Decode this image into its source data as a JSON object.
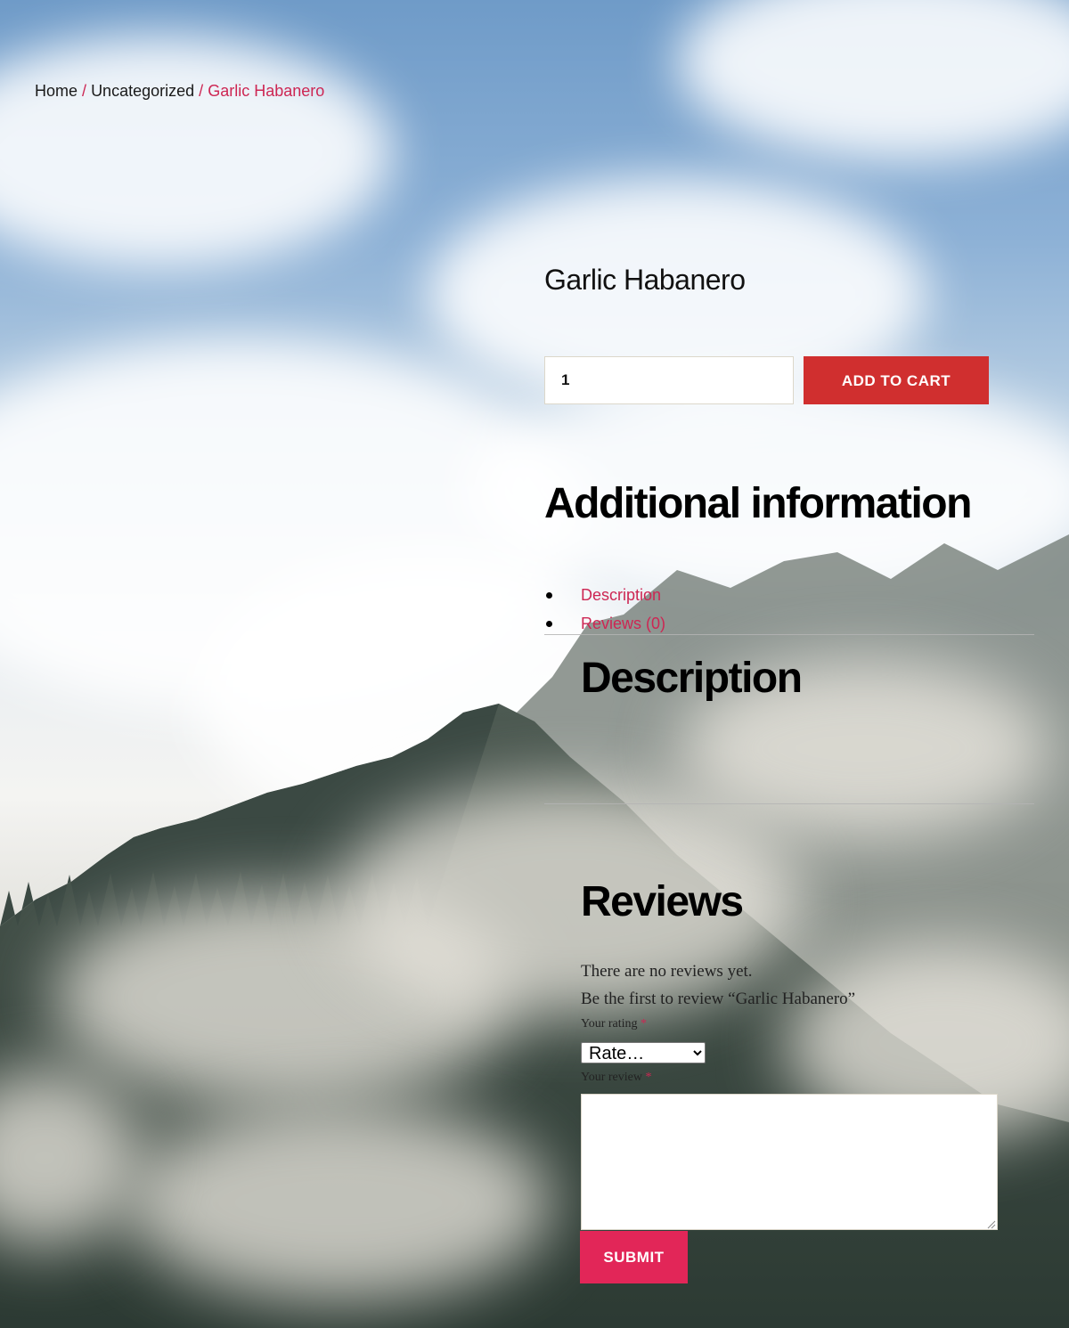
{
  "breadcrumb": {
    "home": "Home",
    "separator": "/",
    "category": "Uncategorized",
    "current": "Garlic Habanero"
  },
  "product": {
    "title": "Garlic Habanero",
    "quantity": "1",
    "add_to_cart_label": "ADD TO CART"
  },
  "additional_information": {
    "heading": "Additional information"
  },
  "tabs": [
    {
      "label": "Description"
    },
    {
      "label": "Reviews (0)"
    }
  ],
  "description": {
    "heading": "Description"
  },
  "reviews": {
    "heading": "Reviews",
    "no_reviews_text": "There are no reviews yet.",
    "first_review_text": "Be the first to review “Garlic Habanero”",
    "rating_label": "Your rating",
    "rating_select_value": "Rate…",
    "review_label": "Your review",
    "required_marker": "*",
    "submit_label": "SUBMIT"
  },
  "colors": {
    "accent": "#cd2653",
    "add_to_cart_bg": "#d02f2f",
    "submit_bg": "#e22658"
  },
  "icons": [
    "resize-grip-icon",
    "chevron-down-icon"
  ]
}
